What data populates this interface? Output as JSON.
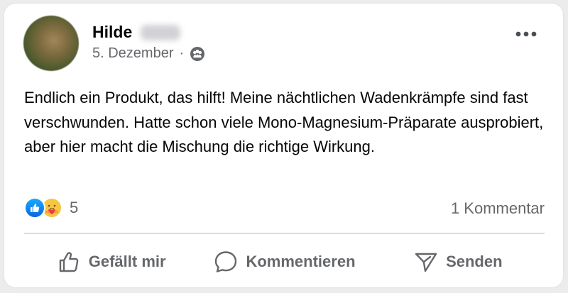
{
  "post": {
    "author_name": "Hilde",
    "date": "5. Dezember",
    "meta_separator": "·",
    "audience_icon": "friends-icon",
    "text": "Endlich ein Produkt, das hilft! Meine nächtlichen Wadenkrämpfe sind fast verschwunden. Hatte schon viele Mono-Magnesium-Präparate ausprobiert, aber hier macht die Mischung die richtige Wirkung."
  },
  "engagement": {
    "reaction_icons": [
      "like-icon",
      "care-icon"
    ],
    "reaction_count": "5",
    "comment_count_label": "1 Kommentar"
  },
  "actions": {
    "like_label": "Gefällt mir",
    "comment_label": "Kommentieren",
    "share_label": "Senden"
  },
  "colors": {
    "text_primary": "#050505",
    "text_secondary": "#65676b",
    "like_blue": "#0a66e0",
    "care_yellow": "#f7c544",
    "divider": "#dadde1"
  }
}
